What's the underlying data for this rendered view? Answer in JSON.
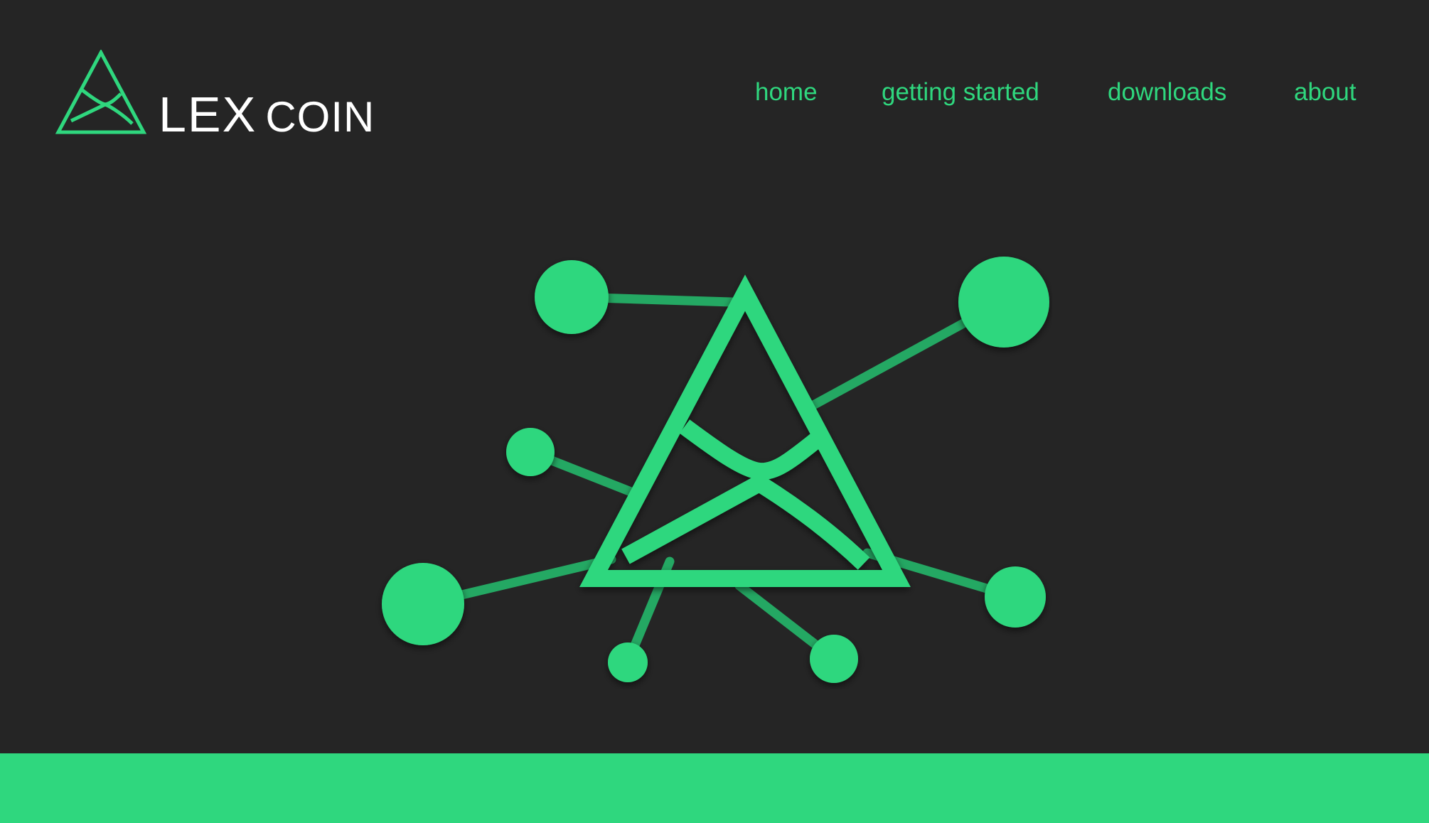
{
  "brand": {
    "name_primary": "LEX",
    "name_secondary": "COIN",
    "logo_icon": "triangle-network-logo-icon"
  },
  "nav": {
    "items": [
      {
        "label": "home"
      },
      {
        "label": "getting started"
      },
      {
        "label": "downloads"
      },
      {
        "label": "about"
      }
    ]
  },
  "hero": {
    "graphic_icon": "lexcoin-network-triangle-icon"
  },
  "colors": {
    "background": "#252525",
    "accent": "#2fd77e",
    "accent_dark": "#24a863",
    "brand_text": "#ffffff"
  }
}
